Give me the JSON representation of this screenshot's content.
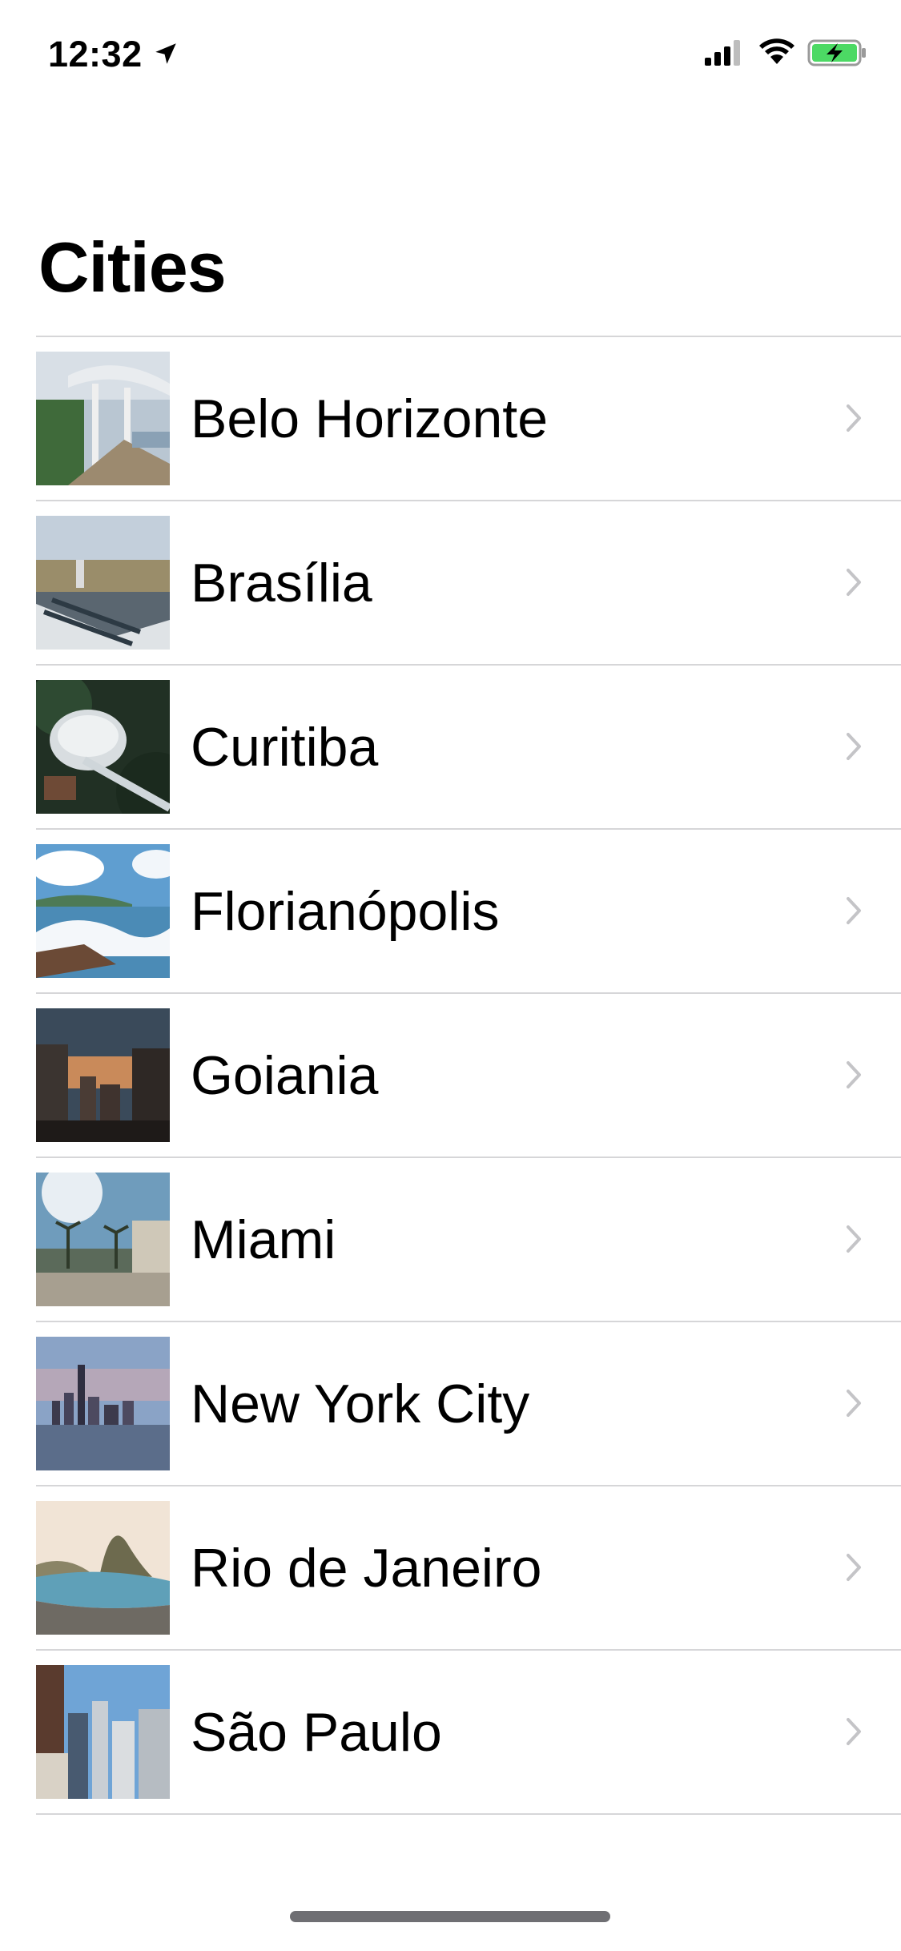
{
  "status_bar": {
    "time": "12:32"
  },
  "title": "Cities",
  "cities": [
    {
      "name": "Belo Horizonte",
      "image": "belo-horizonte-photo"
    },
    {
      "name": "Brasília",
      "image": "brasilia-photo"
    },
    {
      "name": "Curitiba",
      "image": "curitiba-photo"
    },
    {
      "name": "Florianópolis",
      "image": "florianopolis-photo"
    },
    {
      "name": "Goiania",
      "image": "goiania-photo"
    },
    {
      "name": "Miami",
      "image": "miami-photo"
    },
    {
      "name": "New York City",
      "image": "new-york-city-photo"
    },
    {
      "name": "Rio de Janeiro",
      "image": "rio-de-janeiro-photo"
    },
    {
      "name": "São Paulo",
      "image": "sao-paulo-photo"
    }
  ],
  "colors": {
    "separator": "#d6d6d8",
    "chevron": "#c4c4c7",
    "battery_fill": "#4cd964",
    "home_indicator": "#6f6f73"
  }
}
